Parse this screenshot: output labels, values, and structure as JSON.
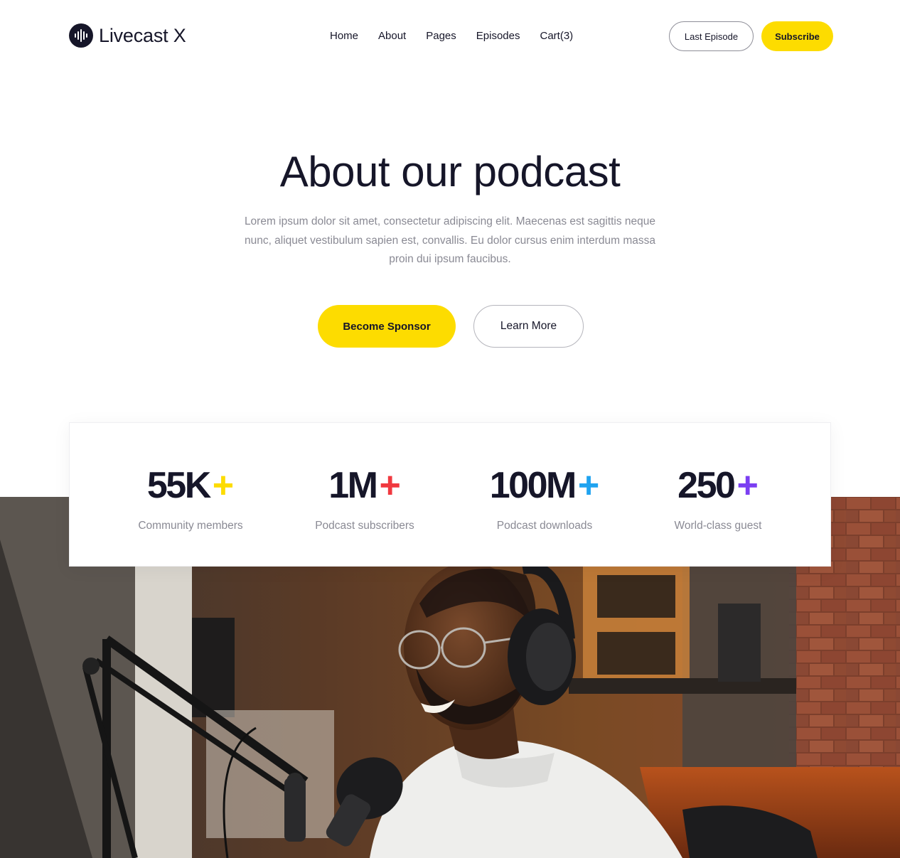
{
  "brand": {
    "name": "Livecast X",
    "logo_icon": "sound-wave-icon"
  },
  "nav": {
    "items": [
      {
        "label": "Home"
      },
      {
        "label": "About"
      },
      {
        "label": "Pages"
      },
      {
        "label": "Episodes"
      },
      {
        "label": "Cart(3)"
      }
    ]
  },
  "header_actions": {
    "last_episode_label": "Last Episode",
    "subscribe_label": "Subscribe"
  },
  "hero": {
    "title": "About our podcast",
    "description": "Lorem ipsum dolor sit amet, consectetur adipiscing elit. Maecenas est sagittis neque nunc, aliquet vestibulum sapien est, convallis. Eu dolor cursus enim interdum massa proin dui ipsum faucibus.",
    "primary_cta": "Become Sponsor",
    "secondary_cta": "Learn More"
  },
  "stats": [
    {
      "value": "55K",
      "plus": "+",
      "label": "Community members",
      "plus_color": "#fddc00"
    },
    {
      "value": "1M",
      "plus": "+",
      "label": "Podcast subscribers",
      "plus_color": "#f0393f"
    },
    {
      "value": "100M",
      "plus": "+",
      "label": "Podcast downloads",
      "plus_color": "#1fa3f0"
    },
    {
      "value": "250",
      "plus": "+",
      "label": "World-class guest",
      "plus_color": "#7b3ff2"
    }
  ],
  "colors": {
    "accent": "#fddc00",
    "text": "#161629",
    "muted": "#8a8a94"
  }
}
